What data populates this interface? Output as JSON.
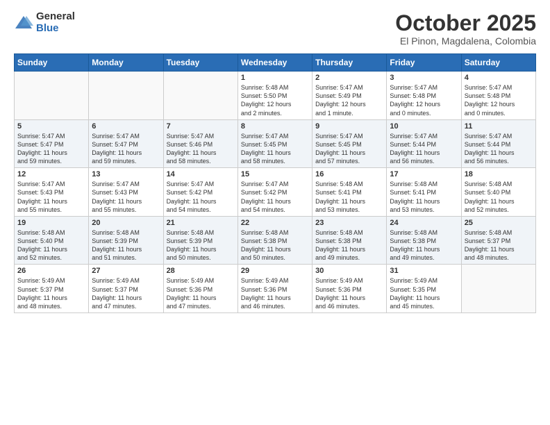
{
  "logo": {
    "general": "General",
    "blue": "Blue"
  },
  "title": {
    "month": "October 2025",
    "location": "El Pinon, Magdalena, Colombia"
  },
  "weekdays": [
    "Sunday",
    "Monday",
    "Tuesday",
    "Wednesday",
    "Thursday",
    "Friday",
    "Saturday"
  ],
  "weeks": [
    [
      {
        "day": "",
        "info": ""
      },
      {
        "day": "",
        "info": ""
      },
      {
        "day": "",
        "info": ""
      },
      {
        "day": "1",
        "info": "Sunrise: 5:48 AM\nSunset: 5:50 PM\nDaylight: 12 hours\nand 2 minutes."
      },
      {
        "day": "2",
        "info": "Sunrise: 5:47 AM\nSunset: 5:49 PM\nDaylight: 12 hours\nand 1 minute."
      },
      {
        "day": "3",
        "info": "Sunrise: 5:47 AM\nSunset: 5:48 PM\nDaylight: 12 hours\nand 0 minutes."
      },
      {
        "day": "4",
        "info": "Sunrise: 5:47 AM\nSunset: 5:48 PM\nDaylight: 12 hours\nand 0 minutes."
      }
    ],
    [
      {
        "day": "5",
        "info": "Sunrise: 5:47 AM\nSunset: 5:47 PM\nDaylight: 11 hours\nand 59 minutes."
      },
      {
        "day": "6",
        "info": "Sunrise: 5:47 AM\nSunset: 5:47 PM\nDaylight: 11 hours\nand 59 minutes."
      },
      {
        "day": "7",
        "info": "Sunrise: 5:47 AM\nSunset: 5:46 PM\nDaylight: 11 hours\nand 58 minutes."
      },
      {
        "day": "8",
        "info": "Sunrise: 5:47 AM\nSunset: 5:45 PM\nDaylight: 11 hours\nand 58 minutes."
      },
      {
        "day": "9",
        "info": "Sunrise: 5:47 AM\nSunset: 5:45 PM\nDaylight: 11 hours\nand 57 minutes."
      },
      {
        "day": "10",
        "info": "Sunrise: 5:47 AM\nSunset: 5:44 PM\nDaylight: 11 hours\nand 56 minutes."
      },
      {
        "day": "11",
        "info": "Sunrise: 5:47 AM\nSunset: 5:44 PM\nDaylight: 11 hours\nand 56 minutes."
      }
    ],
    [
      {
        "day": "12",
        "info": "Sunrise: 5:47 AM\nSunset: 5:43 PM\nDaylight: 11 hours\nand 55 minutes."
      },
      {
        "day": "13",
        "info": "Sunrise: 5:47 AM\nSunset: 5:43 PM\nDaylight: 11 hours\nand 55 minutes."
      },
      {
        "day": "14",
        "info": "Sunrise: 5:47 AM\nSunset: 5:42 PM\nDaylight: 11 hours\nand 54 minutes."
      },
      {
        "day": "15",
        "info": "Sunrise: 5:47 AM\nSunset: 5:42 PM\nDaylight: 11 hours\nand 54 minutes."
      },
      {
        "day": "16",
        "info": "Sunrise: 5:48 AM\nSunset: 5:41 PM\nDaylight: 11 hours\nand 53 minutes."
      },
      {
        "day": "17",
        "info": "Sunrise: 5:48 AM\nSunset: 5:41 PM\nDaylight: 11 hours\nand 53 minutes."
      },
      {
        "day": "18",
        "info": "Sunrise: 5:48 AM\nSunset: 5:40 PM\nDaylight: 11 hours\nand 52 minutes."
      }
    ],
    [
      {
        "day": "19",
        "info": "Sunrise: 5:48 AM\nSunset: 5:40 PM\nDaylight: 11 hours\nand 52 minutes."
      },
      {
        "day": "20",
        "info": "Sunrise: 5:48 AM\nSunset: 5:39 PM\nDaylight: 11 hours\nand 51 minutes."
      },
      {
        "day": "21",
        "info": "Sunrise: 5:48 AM\nSunset: 5:39 PM\nDaylight: 11 hours\nand 50 minutes."
      },
      {
        "day": "22",
        "info": "Sunrise: 5:48 AM\nSunset: 5:38 PM\nDaylight: 11 hours\nand 50 minutes."
      },
      {
        "day": "23",
        "info": "Sunrise: 5:48 AM\nSunset: 5:38 PM\nDaylight: 11 hours\nand 49 minutes."
      },
      {
        "day": "24",
        "info": "Sunrise: 5:48 AM\nSunset: 5:38 PM\nDaylight: 11 hours\nand 49 minutes."
      },
      {
        "day": "25",
        "info": "Sunrise: 5:48 AM\nSunset: 5:37 PM\nDaylight: 11 hours\nand 48 minutes."
      }
    ],
    [
      {
        "day": "26",
        "info": "Sunrise: 5:49 AM\nSunset: 5:37 PM\nDaylight: 11 hours\nand 48 minutes."
      },
      {
        "day": "27",
        "info": "Sunrise: 5:49 AM\nSunset: 5:37 PM\nDaylight: 11 hours\nand 47 minutes."
      },
      {
        "day": "28",
        "info": "Sunrise: 5:49 AM\nSunset: 5:36 PM\nDaylight: 11 hours\nand 47 minutes."
      },
      {
        "day": "29",
        "info": "Sunrise: 5:49 AM\nSunset: 5:36 PM\nDaylight: 11 hours\nand 46 minutes."
      },
      {
        "day": "30",
        "info": "Sunrise: 5:49 AM\nSunset: 5:36 PM\nDaylight: 11 hours\nand 46 minutes."
      },
      {
        "day": "31",
        "info": "Sunrise: 5:49 AM\nSunset: 5:35 PM\nDaylight: 11 hours\nand 45 minutes."
      },
      {
        "day": "",
        "info": ""
      }
    ]
  ]
}
